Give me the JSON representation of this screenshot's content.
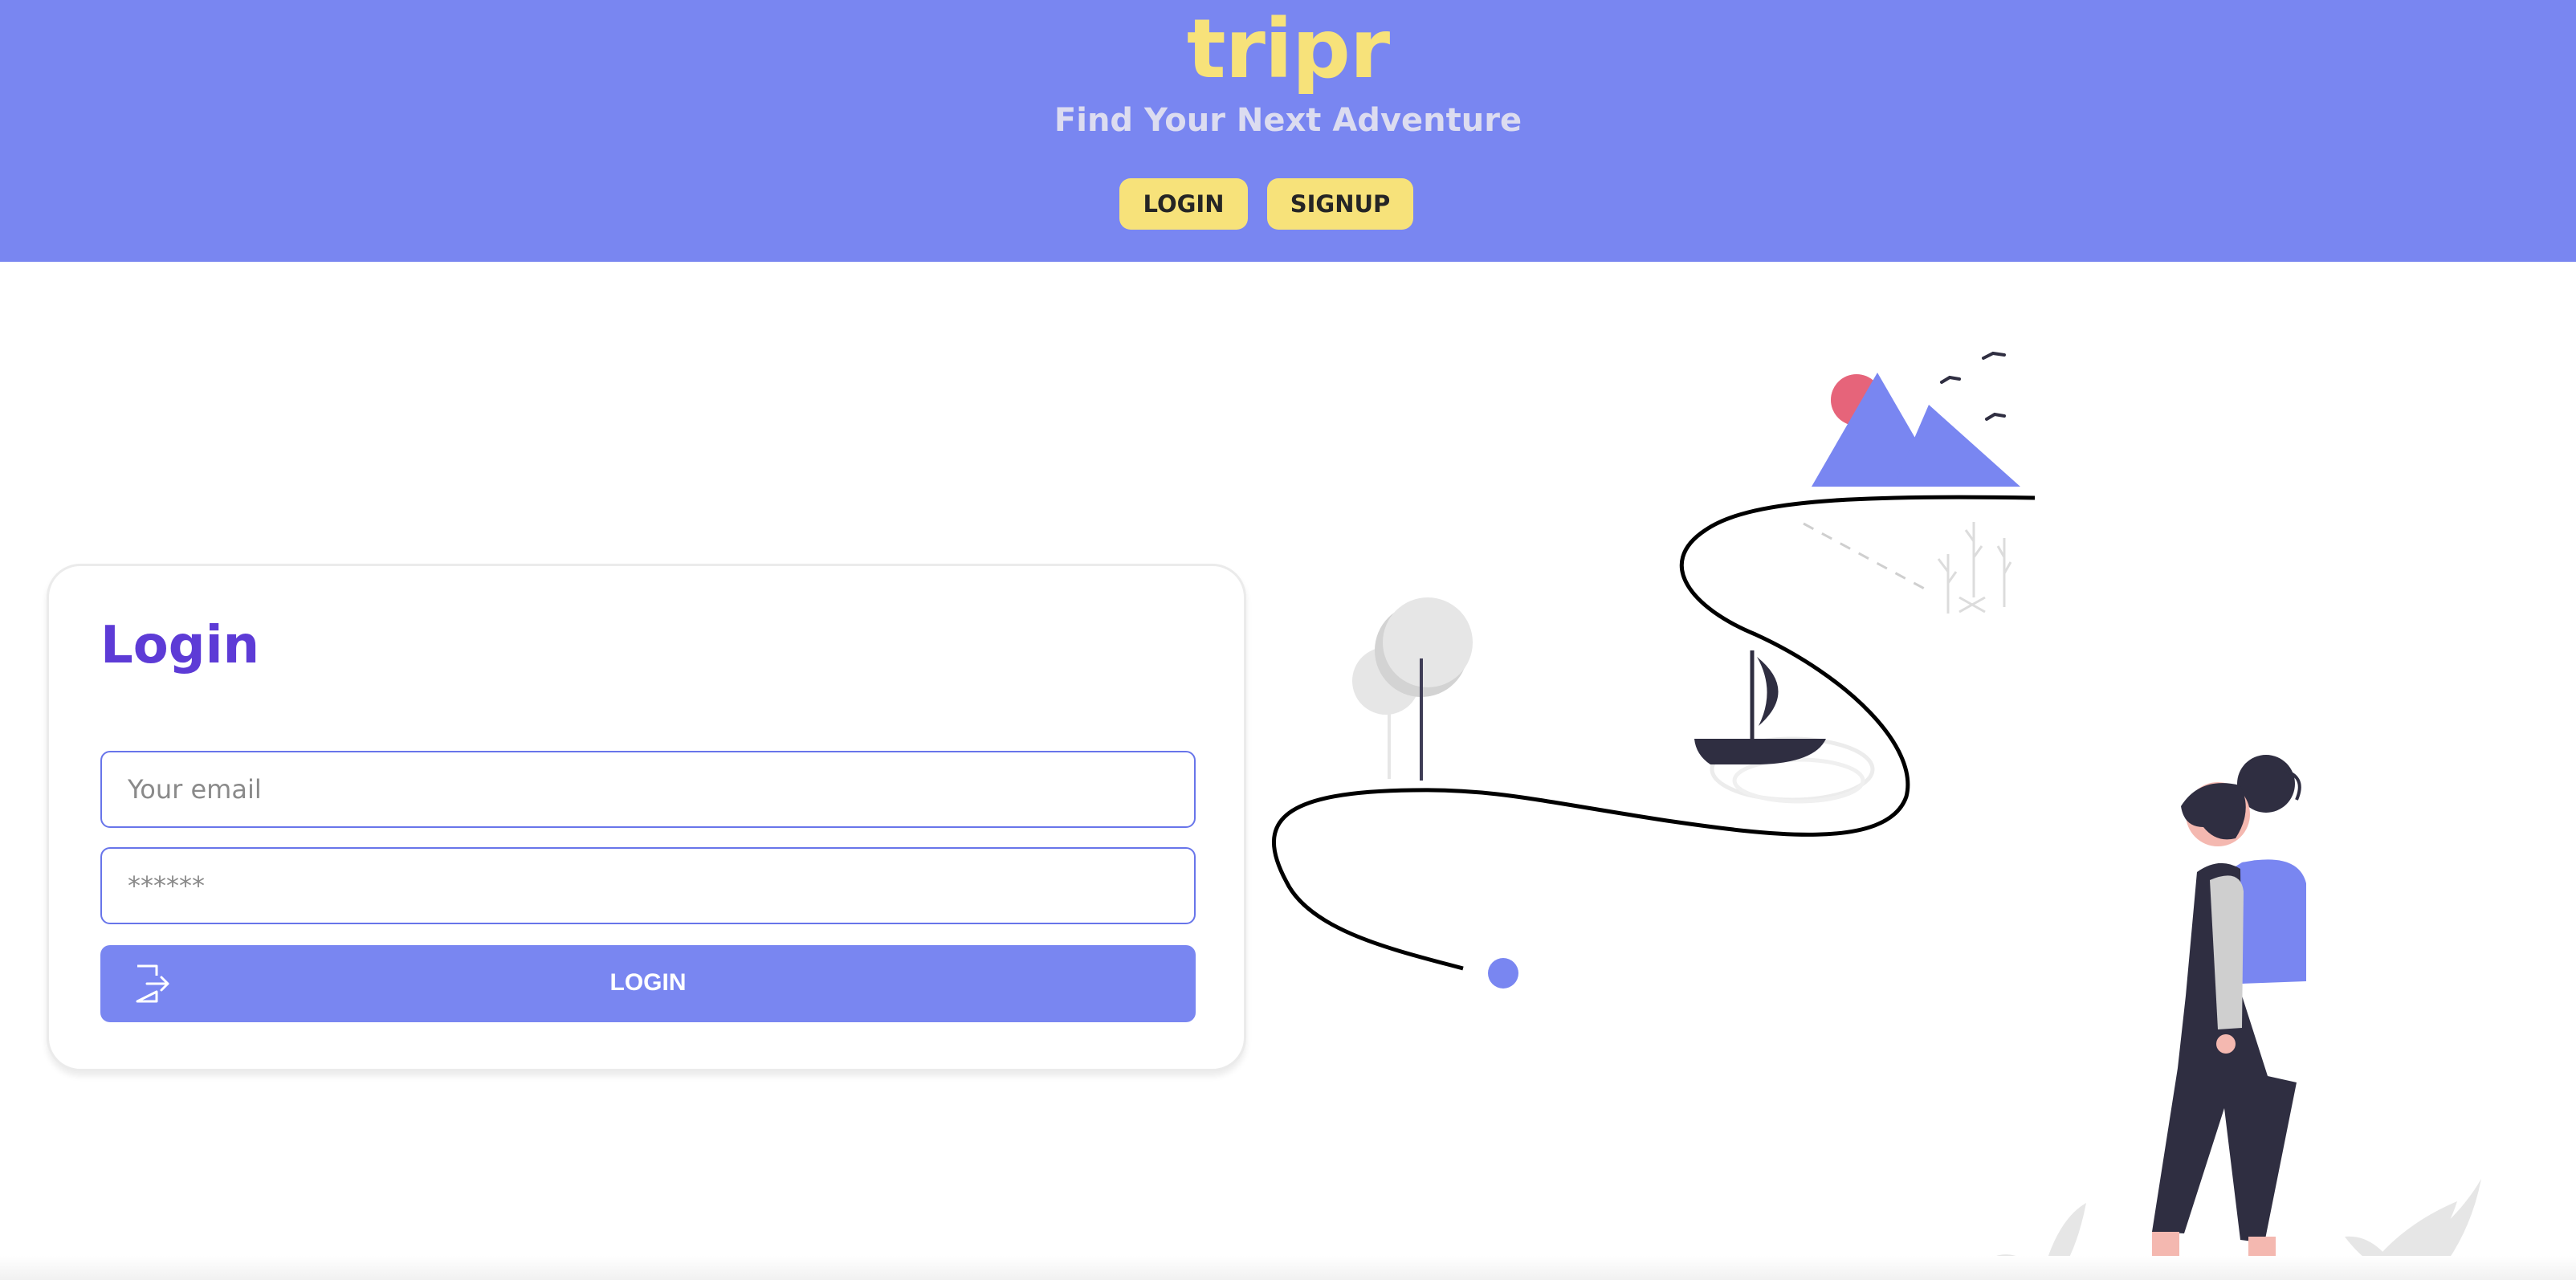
{
  "header": {
    "brand": "tripr",
    "tagline": "Find Your Next Adventure",
    "nav": {
      "login_label": "LOGIN",
      "signup_label": "SIGNUP"
    }
  },
  "login_card": {
    "title": "Login",
    "email_placeholder": "Your email",
    "password_placeholder": "******",
    "submit_label": "LOGIN",
    "submit_icon": "sign-in-icon"
  },
  "colors": {
    "accent": "#7986f1",
    "brand_yellow": "#f7e27a",
    "title_purple": "#5d3bd6",
    "dark": "#2f2e41",
    "sun": "#e6647a"
  }
}
